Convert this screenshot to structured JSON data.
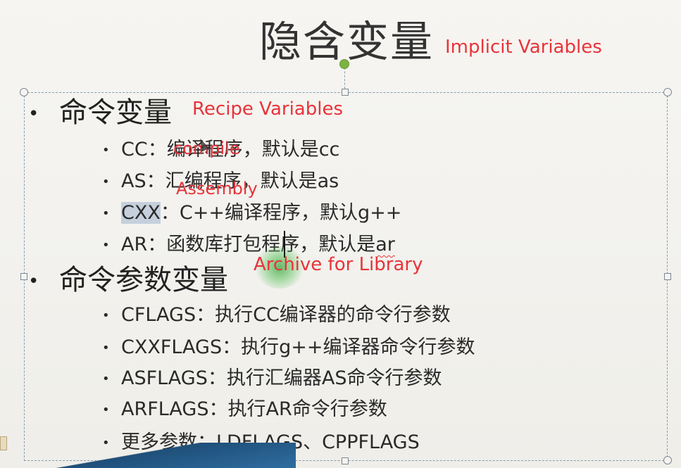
{
  "slide": {
    "title": "隐含变量",
    "annotations": {
      "title": "Implicit Variables",
      "recipe": "Recipe Variables",
      "compile": "compile",
      "assembly": "Assembly",
      "archive": "Archive for Library"
    },
    "sections": [
      {
        "bullet": "•",
        "heading": "命令变量",
        "items": [
          {
            "bullet": "•",
            "text": "CC：编译程序，默认是cc"
          },
          {
            "bullet": "•",
            "text": "AS：汇编程序，默认是as"
          },
          {
            "bullet": "•",
            "prefix": "CXX",
            "text": "：C++编译程序，默认g++"
          },
          {
            "bullet": "•",
            "text": "AR：函数库打包程序，默认是",
            "suffix": "ar"
          }
        ]
      },
      {
        "bullet": "•",
        "heading": "命令参数变量",
        "items": [
          {
            "bullet": "•",
            "text": "CFLAGS：执行CC编译器的命令行参数"
          },
          {
            "bullet": "•",
            "text": "CXXFLAGS：执行g++编译器命令行参数"
          },
          {
            "bullet": "•",
            "text": "ASFLAGS：执行汇编器AS命令行参数"
          },
          {
            "bullet": "•",
            "text": "ARFLAGS：执行AR命令行参数"
          },
          {
            "bullet": "•",
            "text": "更多参数：LDFLAGS、CPPFLAGS"
          }
        ]
      }
    ]
  },
  "colors": {
    "annotation": "#e8333a",
    "selection_border": "#8a9bb0",
    "highlight": "#c5d0dc",
    "rotate_handle": "#7cb342"
  }
}
